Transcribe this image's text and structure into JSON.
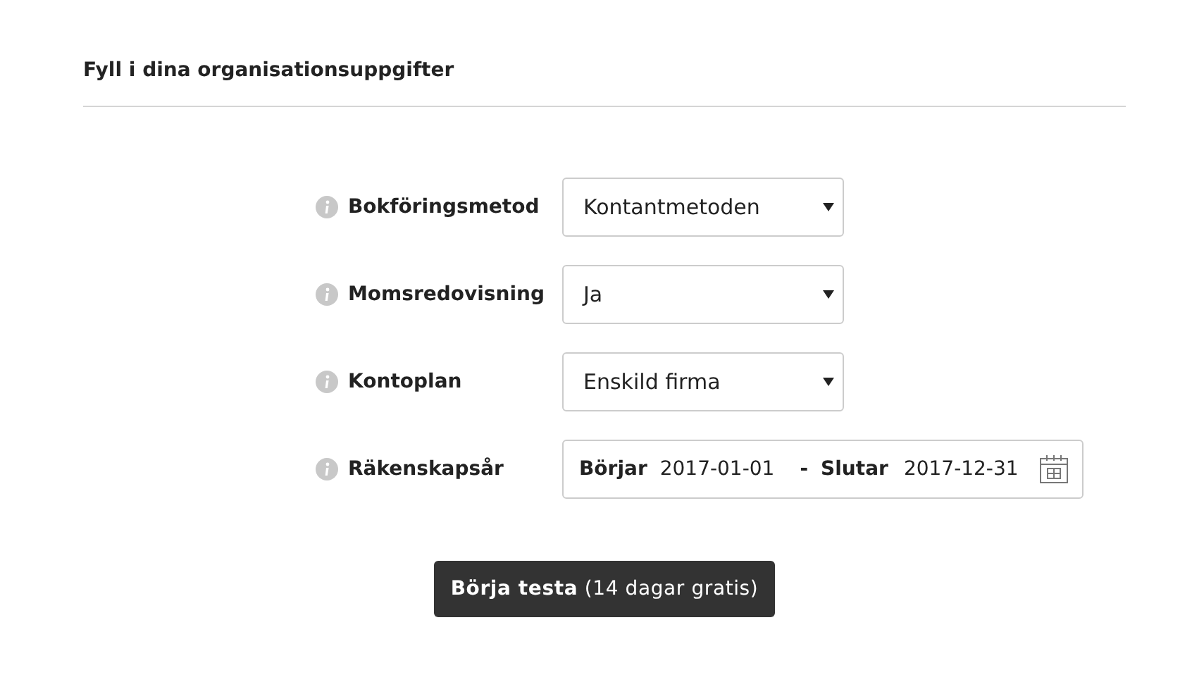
{
  "title": "Fyll i dina organisationsuppgifter",
  "rows": [
    {
      "kind": "select",
      "label": "Bokföringsmetod",
      "value": "Kontantmetoden"
    },
    {
      "kind": "select",
      "label": "Momsredovisning",
      "value": "Ja"
    },
    {
      "kind": "select",
      "label": "Kontoplan",
      "value": "Enskild firma"
    },
    {
      "kind": "daterange",
      "label": "Räkenskapsår",
      "start_label": "Börjar",
      "start": "2017-01-01",
      "separator": "-",
      "end_label": "Slutar",
      "end": "2017-12-31"
    }
  ],
  "submit": "**Börja testa** (14 dagar gratis)"
}
